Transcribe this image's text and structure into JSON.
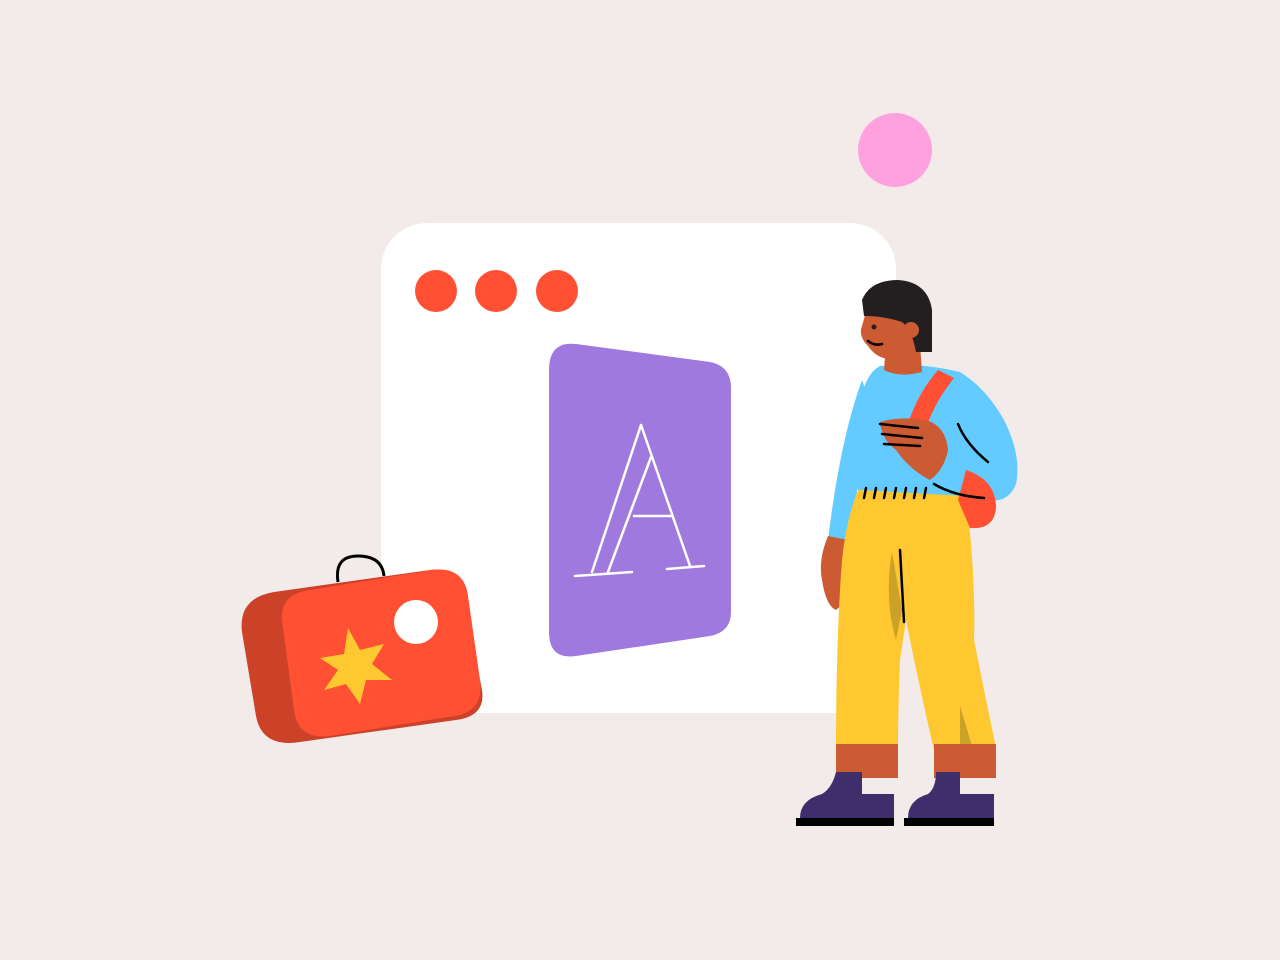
{
  "colors": {
    "background": "#F2EBE9",
    "window": "#FFFFFF",
    "window_dots": "#FF5033",
    "font_card": "#9F79DE",
    "font_glyph_stroke": "#FFFFFF",
    "pink_dot": "#FFA1DF",
    "suitcase_front": "#FF5033",
    "suitcase_side": "#CC4229",
    "suitcase_star": "#FFC831",
    "skin": "#CC5B33",
    "hair": "#231F20",
    "sweater": "#63CBFF",
    "bag_strap": "#FF5033",
    "trousers": "#FFC831",
    "trousers_shadow": "#CCA128",
    "shoes": "#3E2E6B",
    "outline": "#000000"
  },
  "window": {
    "dots": [
      "red-dot",
      "red-dot",
      "red-dot"
    ]
  },
  "font_card": {
    "glyph": "A"
  },
  "icons": [
    "browser-window-icon",
    "font-a-icon",
    "suitcase-icon",
    "star-icon",
    "pink-circle-icon",
    "person-illustration"
  ]
}
